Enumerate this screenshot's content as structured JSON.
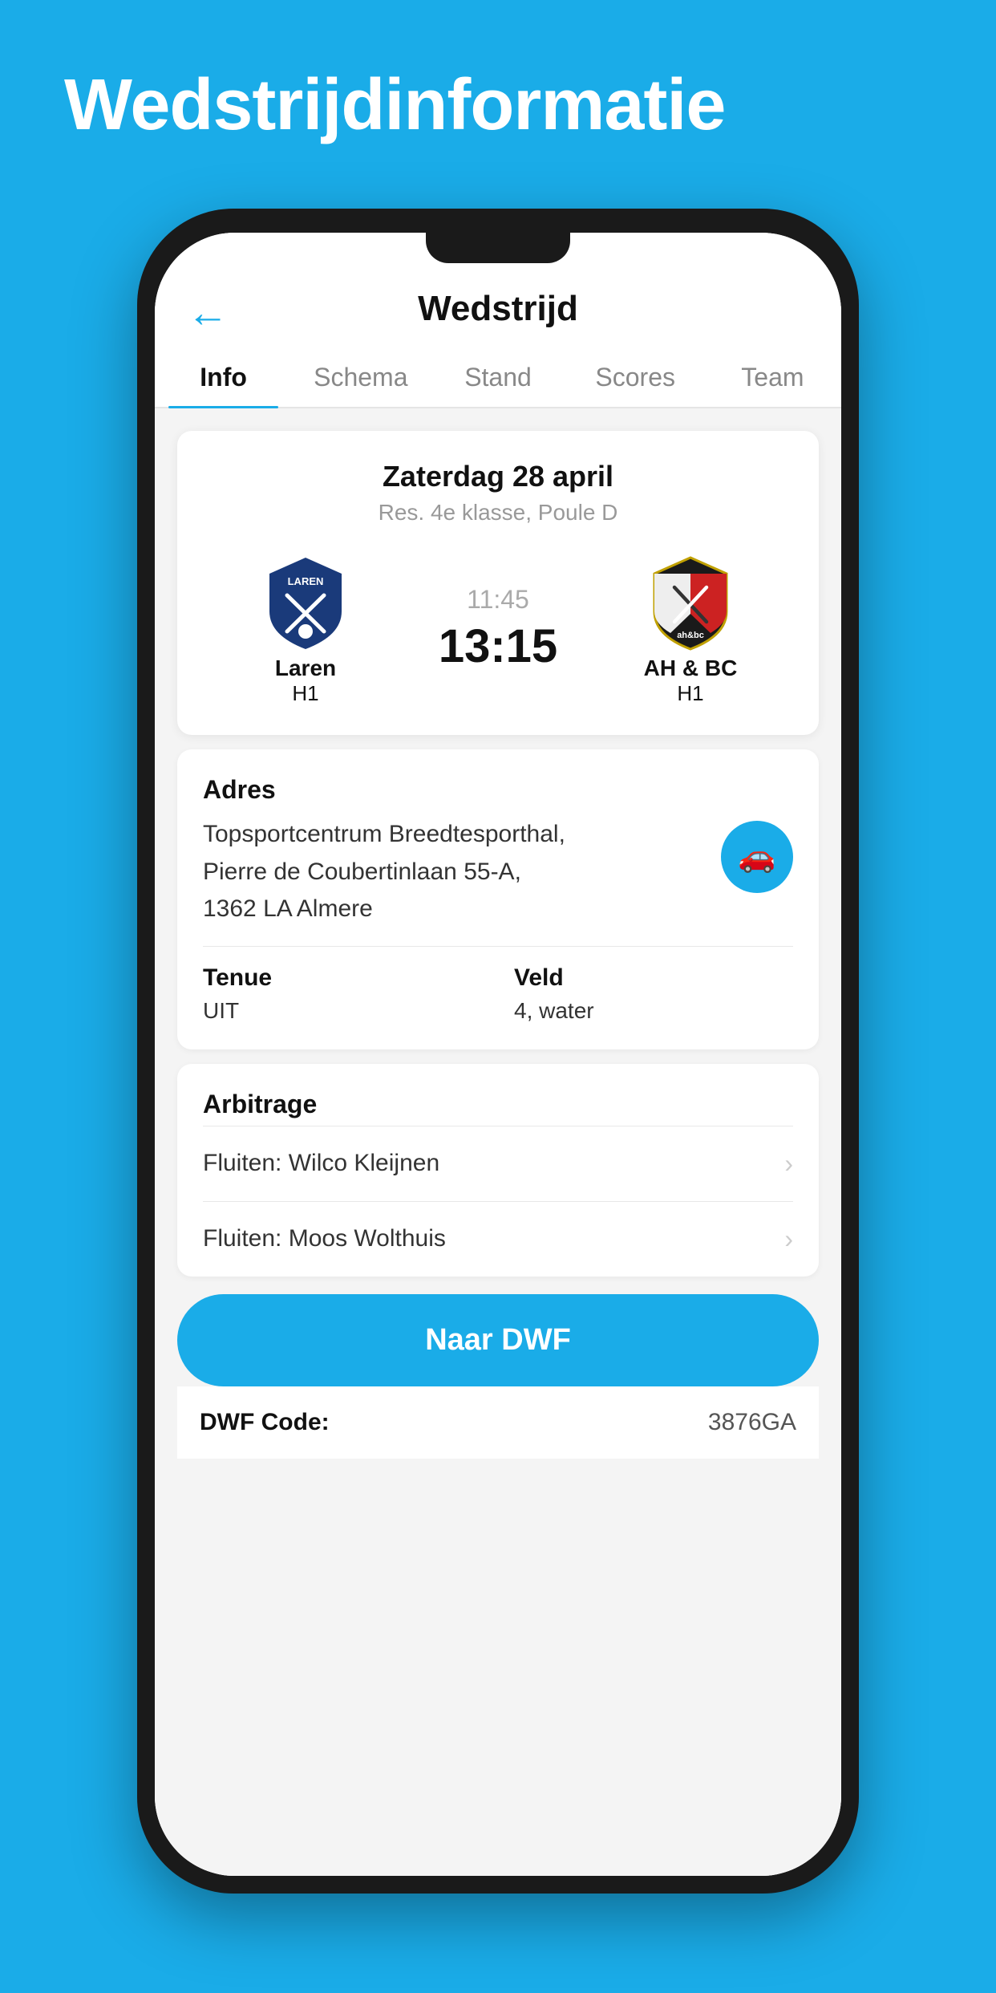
{
  "page": {
    "background_title": "Wedstrijdinformatie",
    "header": {
      "back_label": "←",
      "title": "Wedstrijd"
    },
    "tabs": [
      {
        "label": "Info",
        "active": true
      },
      {
        "label": "Schema",
        "active": false
      },
      {
        "label": "Stand",
        "active": false
      },
      {
        "label": "Scores",
        "active": false
      },
      {
        "label": "Team",
        "active": false
      }
    ],
    "match_card": {
      "date": "Zaterdag 28 april",
      "league": "Res. 4e klasse, Poule D",
      "team_home": "Laren",
      "team_home_sub": "H1",
      "team_away": "AH & BC",
      "team_away_sub": "H1",
      "score_time": "11:45",
      "score_main": "13:15"
    },
    "info_section": {
      "address_label": "Adres",
      "address_text": "Topsportcentrum Breedtesporthal,\nPierre de Coubertinlaan 55-A,\n1362 LA Almere",
      "tenue_label": "Tenue",
      "tenue_value": "UIT",
      "veld_label": "Veld",
      "veld_value": "4, water"
    },
    "arbitrage_section": {
      "label": "Arbitrage",
      "referees": [
        {
          "text": "Fluiten: Wilco Kleijnen"
        },
        {
          "text": "Fluiten: Moos Wolthuis"
        }
      ]
    },
    "dwf": {
      "button_label": "Naar DWF",
      "code_label": "DWF Code:",
      "code_value": "3876GA"
    }
  }
}
